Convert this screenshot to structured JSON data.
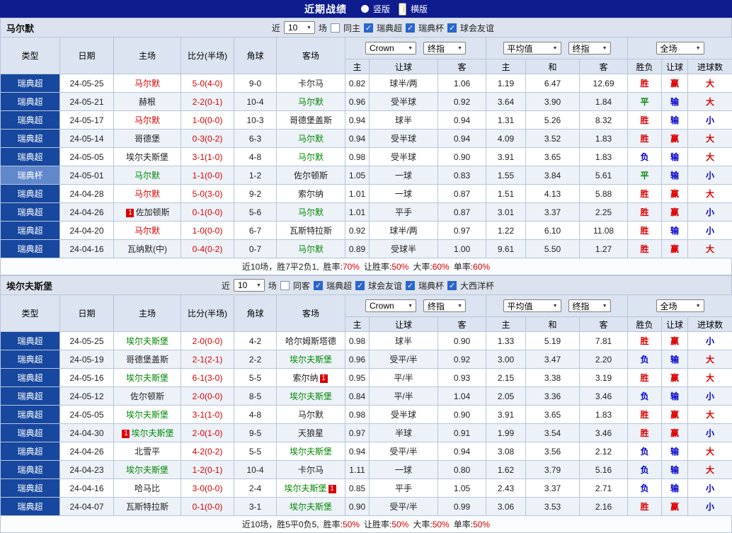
{
  "colors": {
    "red": "#dd0000",
    "green": "#008800",
    "blue": "#0000cc",
    "black": "#222222",
    "navy": "#0e1c8e",
    "league_bg": "#17479e",
    "cup_bg": "#6288cc",
    "accent_orange": "#ff9900"
  },
  "result_colors": {
    "胜": "red",
    "平": "green",
    "负": "blue",
    "赢": "red",
    "输": "blue",
    "大": "red",
    "小": "blue"
  },
  "topbar": {
    "title": "近期战绩",
    "radios": [
      {
        "label": "竖版",
        "selected": false
      },
      {
        "label": "横版",
        "selected": true
      }
    ]
  },
  "table_header": {
    "static_cols": [
      "类型",
      "日期",
      "主场",
      "比分(半场)",
      "角球",
      "客场"
    ],
    "group1": {
      "select1": "Crown",
      "select2": "终指",
      "subcols": [
        "主",
        "让球",
        "客"
      ]
    },
    "group2": {
      "select1": "平均值",
      "select2": "终指",
      "subcols": [
        "主",
        "和",
        "客"
      ]
    },
    "group3": {
      "select1": "全场",
      "subcols": [
        "胜负",
        "让球",
        "进球数"
      ]
    }
  },
  "sections": [
    {
      "team": "马尔默",
      "filter": {
        "near": "近",
        "count": "10",
        "games": "场",
        "venue": {
          "label": "同主",
          "checked": false
        },
        "competitions": [
          {
            "label": "瑞典超",
            "checked": true
          },
          {
            "label": "瑞典杯",
            "checked": true
          },
          {
            "label": "球会友谊",
            "checked": true
          }
        ]
      },
      "rows": [
        {
          "type": "瑞典超",
          "cup": false,
          "date": "24-05-25",
          "home": "马尔默",
          "home_color": "red",
          "home_rc": "",
          "score": "5-0(4-0)",
          "corner": "9-0",
          "away": "卡尔马",
          "away_color": "black",
          "away_rc": "",
          "odds": [
            "0.82",
            "球半/两",
            "1.06",
            "1.19",
            "6.47",
            "12.69"
          ],
          "res": [
            "胜",
            "赢",
            "大"
          ]
        },
        {
          "type": "瑞典超",
          "cup": false,
          "date": "24-05-21",
          "home": "赫根",
          "home_color": "black",
          "home_rc": "",
          "score": "2-2(0-1)",
          "corner": "10-4",
          "away": "马尔默",
          "away_color": "green",
          "away_rc": "",
          "odds": [
            "0.96",
            "受半球",
            "0.92",
            "3.64",
            "3.90",
            "1.84"
          ],
          "res": [
            "平",
            "输",
            "大"
          ]
        },
        {
          "type": "瑞典超",
          "cup": false,
          "date": "24-05-17",
          "home": "马尔默",
          "home_color": "red",
          "home_rc": "",
          "score": "1-0(0-0)",
          "corner": "10-3",
          "away": "哥德堡盖斯",
          "away_color": "black",
          "away_rc": "",
          "odds": [
            "0.94",
            "球半",
            "0.94",
            "1.31",
            "5.26",
            "8.32"
          ],
          "res": [
            "胜",
            "输",
            "小"
          ]
        },
        {
          "type": "瑞典超",
          "cup": false,
          "date": "24-05-14",
          "home": "哥德堡",
          "home_color": "black",
          "home_rc": "",
          "score": "0-3(0-2)",
          "corner": "6-3",
          "away": "马尔默",
          "away_color": "green",
          "away_rc": "",
          "odds": [
            "0.94",
            "受半球",
            "0.94",
            "4.09",
            "3.52",
            "1.83"
          ],
          "res": [
            "胜",
            "赢",
            "大"
          ]
        },
        {
          "type": "瑞典超",
          "cup": false,
          "date": "24-05-05",
          "home": "埃尔夫斯堡",
          "home_color": "black",
          "home_rc": "",
          "score": "3-1(1-0)",
          "corner": "4-8",
          "away": "马尔默",
          "away_color": "green",
          "away_rc": "",
          "odds": [
            "0.98",
            "受半球",
            "0.90",
            "3.91",
            "3.65",
            "1.83"
          ],
          "res": [
            "负",
            "输",
            "大"
          ]
        },
        {
          "type": "瑞典杯",
          "cup": true,
          "date": "24-05-01",
          "home": "马尔默",
          "home_color": "green",
          "home_rc": "",
          "score": "1-1(0-0)",
          "corner": "1-2",
          "away": "佐尔顿斯",
          "away_color": "black",
          "away_rc": "",
          "odds": [
            "1.05",
            "一球",
            "0.83",
            "1.55",
            "3.84",
            "5.61"
          ],
          "res": [
            "平",
            "输",
            "小"
          ]
        },
        {
          "type": "瑞典超",
          "cup": false,
          "date": "24-04-28",
          "home": "马尔默",
          "home_color": "red",
          "home_rc": "",
          "score": "5-0(3-0)",
          "corner": "9-2",
          "away": "索尔纳",
          "away_color": "black",
          "away_rc": "",
          "odds": [
            "1.01",
            "一球",
            "0.87",
            "1.51",
            "4.13",
            "5.88"
          ],
          "res": [
            "胜",
            "赢",
            "大"
          ]
        },
        {
          "type": "瑞典超",
          "cup": false,
          "date": "24-04-26",
          "home": "佐加顿斯",
          "home_color": "black",
          "home_rc": "1",
          "score": "0-1(0-0)",
          "corner": "5-6",
          "away": "马尔默",
          "away_color": "green",
          "away_rc": "",
          "odds": [
            "1.01",
            "平手",
            "0.87",
            "3.01",
            "3.37",
            "2.25"
          ],
          "res": [
            "胜",
            "赢",
            "小"
          ]
        },
        {
          "type": "瑞典超",
          "cup": false,
          "date": "24-04-20",
          "home": "马尔默",
          "home_color": "red",
          "home_rc": "",
          "score": "1-0(0-0)",
          "corner": "6-7",
          "away": "瓦斯特拉斯",
          "away_color": "black",
          "away_rc": "",
          "odds": [
            "0.92",
            "球半/两",
            "0.97",
            "1.22",
            "6.10",
            "11.08"
          ],
          "res": [
            "胜",
            "输",
            "小"
          ]
        },
        {
          "type": "瑞典超",
          "cup": false,
          "date": "24-04-16",
          "home": "瓦纳默(中)",
          "home_color": "black",
          "home_rc": "",
          "score": "0-4(0-2)",
          "corner": "0-7",
          "away": "马尔默",
          "away_color": "green",
          "away_rc": "",
          "odds": [
            "0.89",
            "受球半",
            "1.00",
            "9.61",
            "5.50",
            "1.27"
          ],
          "res": [
            "胜",
            "赢",
            "大"
          ]
        }
      ],
      "summary": {
        "lead": "近10场，胜7平2负1,",
        "stats": [
          {
            "label": "胜率:",
            "value": "70%"
          },
          {
            "label": "让胜率:",
            "value": "50%"
          },
          {
            "label": "大率:",
            "value": "60%"
          },
          {
            "label": "单率:",
            "value": "60%"
          }
        ]
      }
    },
    {
      "team": "埃尔夫斯堡",
      "filter": {
        "near": "近",
        "count": "10",
        "games": "场",
        "venue": {
          "label": "同客",
          "checked": false
        },
        "competitions": [
          {
            "label": "瑞典超",
            "checked": true
          },
          {
            "label": "球会友谊",
            "checked": true
          },
          {
            "label": "瑞典杯",
            "checked": true
          },
          {
            "label": "大西洋杯",
            "checked": true
          }
        ]
      },
      "rows": [
        {
          "type": "瑞典超",
          "cup": false,
          "date": "24-05-25",
          "home": "埃尔夫斯堡",
          "home_color": "green",
          "home_rc": "",
          "score": "2-0(0-0)",
          "corner": "4-2",
          "away": "哈尔姆斯塔德",
          "away_color": "black",
          "away_rc": "",
          "odds": [
            "0.98",
            "球半",
            "0.90",
            "1.33",
            "5.19",
            "7.81"
          ],
          "res": [
            "胜",
            "赢",
            "小"
          ]
        },
        {
          "type": "瑞典超",
          "cup": false,
          "date": "24-05-19",
          "home": "哥德堡盖斯",
          "home_color": "black",
          "home_rc": "",
          "score": "2-1(2-1)",
          "corner": "2-2",
          "away": "埃尔夫斯堡",
          "away_color": "green",
          "away_rc": "",
          "odds": [
            "0.96",
            "受平/半",
            "0.92",
            "3.00",
            "3.47",
            "2.20"
          ],
          "res": [
            "负",
            "输",
            "大"
          ]
        },
        {
          "type": "瑞典超",
          "cup": false,
          "date": "24-05-16",
          "home": "埃尔夫斯堡",
          "home_color": "green",
          "home_rc": "",
          "score": "6-1(3-0)",
          "corner": "5-5",
          "away": "索尔纳",
          "away_color": "black",
          "away_rc": "1",
          "odds": [
            "0.95",
            "平/半",
            "0.93",
            "2.15",
            "3.38",
            "3.19"
          ],
          "res": [
            "胜",
            "赢",
            "大"
          ]
        },
        {
          "type": "瑞典超",
          "cup": false,
          "date": "24-05-12",
          "home": "佐尔顿斯",
          "home_color": "black",
          "home_rc": "",
          "score": "2-0(0-0)",
          "corner": "8-5",
          "away": "埃尔夫斯堡",
          "away_color": "green",
          "away_rc": "",
          "odds": [
            "0.84",
            "平/半",
            "1.04",
            "2.05",
            "3.36",
            "3.46"
          ],
          "res": [
            "负",
            "输",
            "小"
          ]
        },
        {
          "type": "瑞典超",
          "cup": false,
          "date": "24-05-05",
          "home": "埃尔夫斯堡",
          "home_color": "green",
          "home_rc": "",
          "score": "3-1(1-0)",
          "corner": "4-8",
          "away": "马尔默",
          "away_color": "black",
          "away_rc": "",
          "odds": [
            "0.98",
            "受半球",
            "0.90",
            "3.91",
            "3.65",
            "1.83"
          ],
          "res": [
            "胜",
            "赢",
            "大"
          ]
        },
        {
          "type": "瑞典超",
          "cup": false,
          "date": "24-04-30",
          "home": "埃尔夫斯堡",
          "home_color": "green",
          "home_rc": "1",
          "score": "2-0(1-0)",
          "corner": "9-5",
          "away": "天狼星",
          "away_color": "black",
          "away_rc": "",
          "odds": [
            "0.97",
            "半球",
            "0.91",
            "1.99",
            "3.54",
            "3.46"
          ],
          "res": [
            "胜",
            "赢",
            "小"
          ]
        },
        {
          "type": "瑞典超",
          "cup": false,
          "date": "24-04-26",
          "home": "北雪平",
          "home_color": "black",
          "home_rc": "",
          "score": "4-2(0-2)",
          "corner": "5-5",
          "away": "埃尔夫斯堡",
          "away_color": "green",
          "away_rc": "",
          "odds": [
            "0.94",
            "受平/半",
            "0.94",
            "3.08",
            "3.56",
            "2.12"
          ],
          "res": [
            "负",
            "输",
            "大"
          ]
        },
        {
          "type": "瑞典超",
          "cup": false,
          "date": "24-04-23",
          "home": "埃尔夫斯堡",
          "home_color": "green",
          "home_rc": "",
          "score": "1-2(0-1)",
          "corner": "10-4",
          "away": "卡尔马",
          "away_color": "black",
          "away_rc": "",
          "odds": [
            "1.11",
            "一球",
            "0.80",
            "1.62",
            "3.79",
            "5.16"
          ],
          "res": [
            "负",
            "输",
            "大"
          ]
        },
        {
          "type": "瑞典超",
          "cup": false,
          "date": "24-04-16",
          "home": "哈马比",
          "home_color": "black",
          "home_rc": "",
          "score": "3-0(0-0)",
          "corner": "2-4",
          "away": "埃尔夫斯堡",
          "away_color": "green",
          "away_rc": "1",
          "odds": [
            "0.85",
            "平手",
            "1.05",
            "2.43",
            "3.37",
            "2.71"
          ],
          "res": [
            "负",
            "输",
            "小"
          ]
        },
        {
          "type": "瑞典超",
          "cup": false,
          "date": "24-04-07",
          "home": "瓦斯特拉斯",
          "home_color": "black",
          "home_rc": "",
          "score": "0-1(0-0)",
          "corner": "3-1",
          "away": "埃尔夫斯堡",
          "away_color": "green",
          "away_rc": "",
          "odds": [
            "0.90",
            "受平/半",
            "0.99",
            "3.06",
            "3.53",
            "2.16"
          ],
          "res": [
            "胜",
            "赢",
            "小"
          ]
        }
      ],
      "summary": {
        "lead": "近10场，胜5平0负5,",
        "stats": [
          {
            "label": "胜率:",
            "value": "50%"
          },
          {
            "label": "让胜率:",
            "value": "50%"
          },
          {
            "label": "大率:",
            "value": "50%"
          },
          {
            "label": "单率:",
            "value": "50%"
          }
        ]
      }
    }
  ]
}
